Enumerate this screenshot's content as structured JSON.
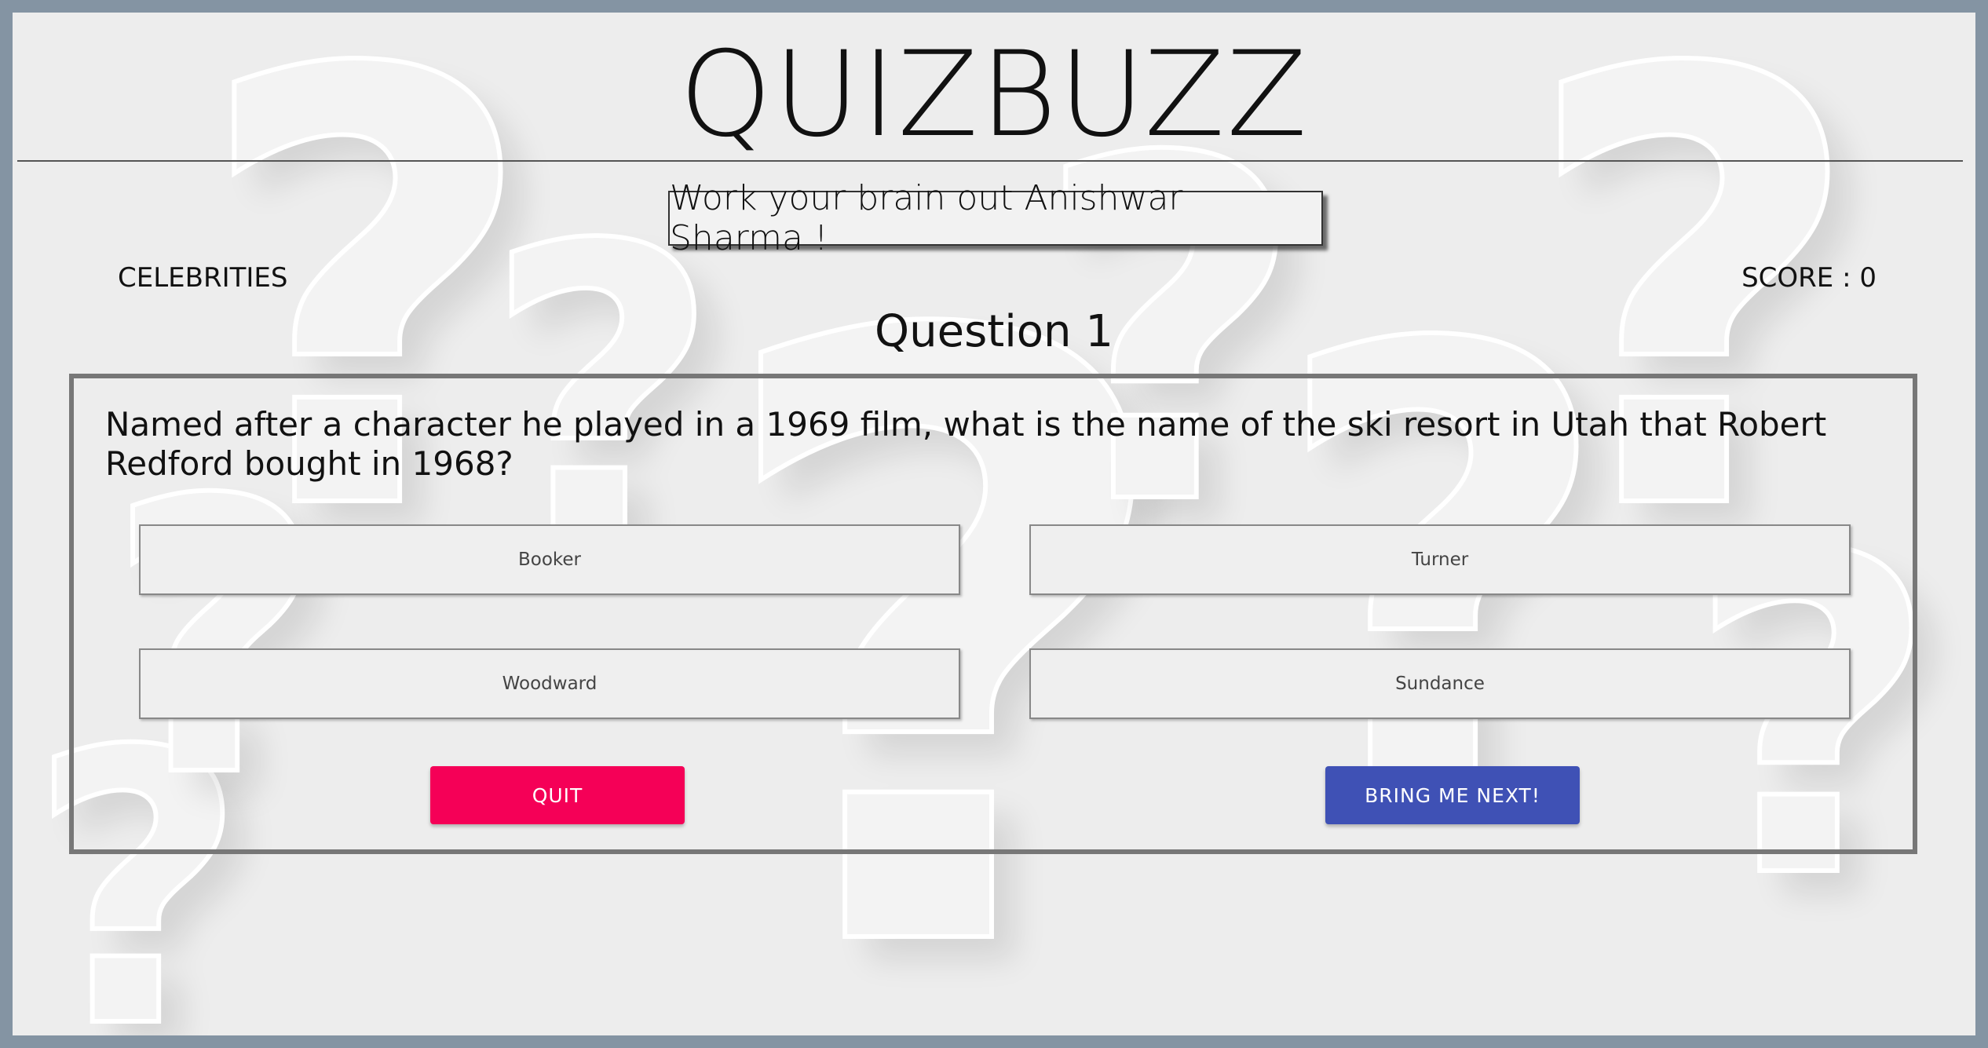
{
  "header": {
    "title": "QUIZBUZZ",
    "greeting": "Work your brain out Anishwar Sharma !"
  },
  "status": {
    "category": "CELEBRITIES",
    "score": "SCORE : 0"
  },
  "question": {
    "number_label": "Question 1",
    "text": "Named after a character he played in a 1969 film, what is the name of the ski resort in Utah that Robert Redford bought in 1968?",
    "options": [
      "Booker",
      "Turner",
      "Woodward",
      "Sundance"
    ]
  },
  "actions": {
    "quit_label": "QUIT",
    "next_label": "BRING ME NEXT!"
  },
  "colors": {
    "outer_border": "#8494a3",
    "background": "#ededed",
    "quit_button": "#f50057",
    "next_button": "#3f51b5"
  },
  "decor": {
    "background_icon": "question-mark-icon"
  }
}
